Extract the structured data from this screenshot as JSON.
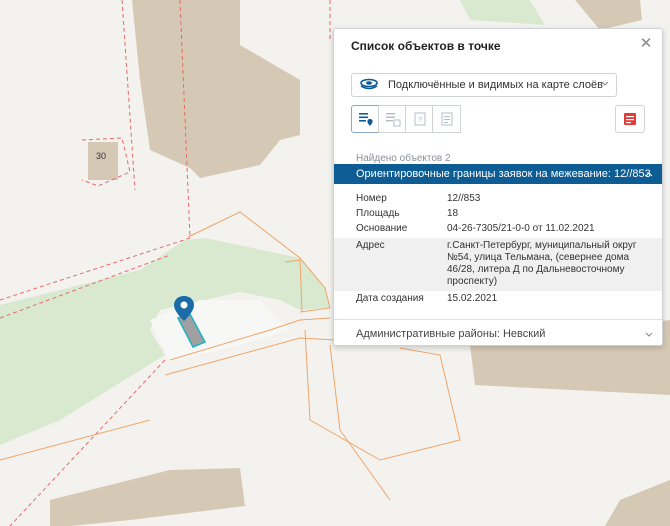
{
  "map": {
    "building_number": "30",
    "colors": {
      "background": "#f3f2ee",
      "building": "#d5c9b5",
      "green_area": "#d9e9cf",
      "boundary_orange": "#f0a56a",
      "boundary_red": "#e86a6a",
      "marker": "#1a6ba8",
      "selected_parcel": "#20b2c2"
    }
  },
  "panel": {
    "title": "Список объектов в точке",
    "close_icon": "close-icon",
    "layer_select": {
      "value": "Подключённые и видимых на карте слоёв",
      "icon": "layers-icon"
    },
    "tools": [
      {
        "name": "tool-list",
        "icon": "list-pin-icon",
        "active": true
      },
      {
        "name": "tool-list-disabled",
        "icon": "list-icon",
        "active": false
      },
      {
        "name": "tool-frame",
        "icon": "frame-icon",
        "active": false
      },
      {
        "name": "tool-doc",
        "icon": "document-icon",
        "active": false
      }
    ],
    "report_icon": "report-icon",
    "found_text": "Найдено объектов 2",
    "section_title": "Ориентировочные границы заявок на межевание: 12//853",
    "properties": [
      {
        "key": "Номер",
        "value": "12//853"
      },
      {
        "key": "Площадь",
        "value": "18"
      },
      {
        "key": "Основание",
        "value": "04-26-7305/21-0-0 от 11.02.2021"
      },
      {
        "key": "Адрес",
        "value": "г.Санкт-Петербург, муниципальный округ №54, улица Тельмана, (севернее дома 46/28, литера Д по Дальневосточному проспекту)"
      },
      {
        "key": "Дата создания",
        "value": "15.02.2021"
      }
    ],
    "second_item": "Административные районы: Невский",
    "accent_color": "#0d5c94"
  }
}
